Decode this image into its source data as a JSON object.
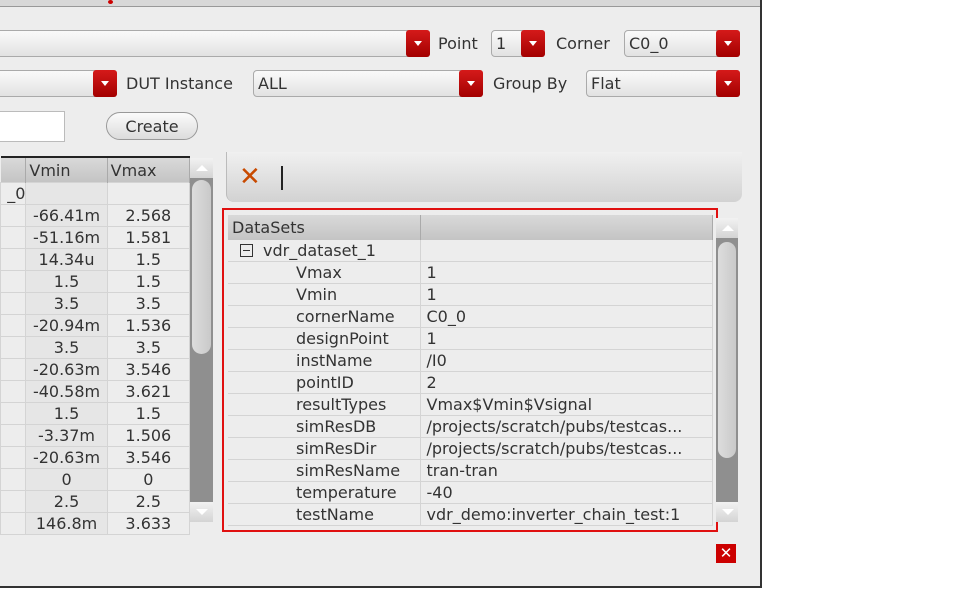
{
  "toolbar_row1": {
    "point_label": "Point",
    "point_value": "1",
    "corner_label": "Corner",
    "corner_value": "C0_0"
  },
  "toolbar_row2": {
    "dut_label": "DUT Instance",
    "dut_value": "ALL",
    "groupby_label": "Group By",
    "groupby_value": "Flat"
  },
  "toolbar_row3": {
    "create_label": "Create"
  },
  "left_table": {
    "headers": [
      "Vmin",
      "Vmax"
    ],
    "first_row_tail": "_0",
    "rows": [
      [
        "-66.41m",
        "2.568"
      ],
      [
        "-51.16m",
        "1.581"
      ],
      [
        "14.34u",
        "1.5"
      ],
      [
        "1.5",
        "1.5"
      ],
      [
        "3.5",
        "3.5"
      ],
      [
        "-20.94m",
        "1.536"
      ],
      [
        "3.5",
        "3.5"
      ],
      [
        "-20.63m",
        "3.546"
      ],
      [
        "-40.58m",
        "3.621"
      ],
      [
        "1.5",
        "1.5"
      ],
      [
        "-3.37m",
        "1.506"
      ],
      [
        "-20.63m",
        "3.546"
      ],
      [
        "0",
        "0"
      ],
      [
        "2.5",
        "2.5"
      ],
      [
        "146.8m",
        "3.633"
      ]
    ]
  },
  "datasets": {
    "header": "DataSets",
    "dataset_name": "vdr_dataset_1",
    "props": [
      [
        "Vmax",
        "1"
      ],
      [
        "Vmin",
        "1"
      ],
      [
        "cornerName",
        "C0_0"
      ],
      [
        "designPoint",
        "1"
      ],
      [
        "instName",
        "/I0"
      ],
      [
        "pointID",
        "2"
      ],
      [
        "resultTypes",
        "Vmax$Vmin$Vsignal"
      ],
      [
        "simResDB",
        "/projects/scratch/pubs/testcas..."
      ],
      [
        "simResDir",
        "/projects/scratch/pubs/testcas..."
      ],
      [
        "simResName",
        "tran-tran"
      ],
      [
        "temperature",
        "-40"
      ],
      [
        "testName",
        "vdr_demo:inverter_chain_test:1"
      ]
    ]
  },
  "colors": {
    "accent": "#c00000",
    "highlight": "#e01010"
  }
}
